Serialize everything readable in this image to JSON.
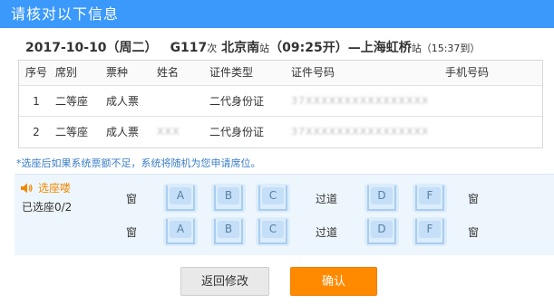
{
  "dialog": {
    "title": "请核对以下信息"
  },
  "trip": {
    "date": "2017-10-10（周二）",
    "train_no": "G117",
    "train_suffix": "次",
    "from": "北京南",
    "station_suffix": "站",
    "depart": "（09:25开）",
    "dash": "—",
    "to": "上海虹桥",
    "station_suffix2": "站",
    "arrive": "（15:37到）"
  },
  "table": {
    "headers": {
      "seq": "序号",
      "seat": "席别",
      "ticket": "票种",
      "name": "姓名",
      "id_type": "证件类型",
      "id_no": "证件号码",
      "phone": "手机号码"
    },
    "rows": [
      {
        "seq": "1",
        "seat": "二等座",
        "ticket": "成人票",
        "name": "",
        "id_type": "二代身份证",
        "id_no": "37XXXXXXXXXXXXXXXX",
        "phone": ""
      },
      {
        "seq": "2",
        "seat": "二等座",
        "ticket": "成人票",
        "name": "XXX",
        "id_type": "二代身份证",
        "id_no": "37XXXXXXXXXXXXXXXX",
        "phone": ""
      }
    ]
  },
  "note": "*选座后如果系统票额不足，系统将随机为您申请席位。",
  "seat_select": {
    "title": "选座喽",
    "chosen": "已选座0/2",
    "window": "窗",
    "aisle": "过道",
    "rows": [
      {
        "seats": [
          "A",
          "B",
          "C",
          "D",
          "F"
        ]
      },
      {
        "seats": [
          "A",
          "B",
          "C",
          "D",
          "F"
        ]
      }
    ]
  },
  "buttons": {
    "back": "返回修改",
    "confirm": "确认"
  },
  "colors": {
    "title_bar": "#3b99fc",
    "confirm": "#ff8a00",
    "accent_orange": "#f08a00",
    "note_blue": "#3b7ec8",
    "seat_panel": "#eef6fd"
  }
}
